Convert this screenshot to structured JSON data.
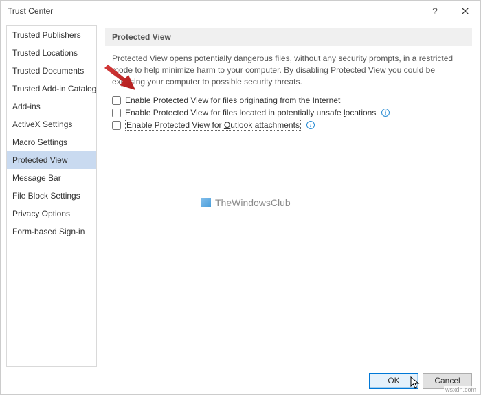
{
  "window": {
    "title": "Trust Center",
    "help_glyph": "?",
    "close_glyph": "✕"
  },
  "sidebar": {
    "items": [
      {
        "label": "Trusted Publishers"
      },
      {
        "label": "Trusted Locations"
      },
      {
        "label": "Trusted Documents"
      },
      {
        "label": "Trusted Add-in Catalogs"
      },
      {
        "label": "Add-ins"
      },
      {
        "label": "ActiveX Settings"
      },
      {
        "label": "Macro Settings"
      },
      {
        "label": "Protected View"
      },
      {
        "label": "Message Bar"
      },
      {
        "label": "File Block Settings"
      },
      {
        "label": "Privacy Options"
      },
      {
        "label": "Form-based Sign-in"
      }
    ],
    "selected_index": 7
  },
  "panel": {
    "header": "Protected View",
    "description": "Protected View opens potentially dangerous files, without any security prompts, in a restricted mode to help minimize harm to your computer. By disabling Protected View you could be exposing your computer to possible security threats.",
    "options": [
      {
        "pre": "Enable Protected View for files originating from the ",
        "ul": "I",
        "post": "nternet",
        "checked": false,
        "info": false
      },
      {
        "pre": "Enable Protected View for files located in potentially unsafe ",
        "ul": "l",
        "post": "ocations",
        "checked": false,
        "info": true
      },
      {
        "pre": "Enable Protected View for ",
        "ul": "O",
        "post": "utlook attachments",
        "checked": false,
        "info": true,
        "dotted": true
      }
    ]
  },
  "watermark": {
    "text": "TheWindowsClub"
  },
  "footer": {
    "ok": "OK",
    "cancel": "Cancel"
  },
  "attribution": "wsxdn.com",
  "info_glyph": "i"
}
